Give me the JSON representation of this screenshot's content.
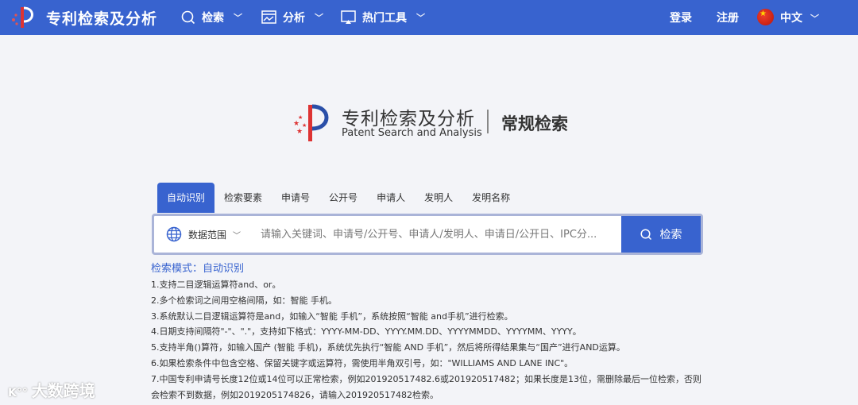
{
  "header": {
    "brand": "专利检索及分析",
    "nav": [
      {
        "label": "检索",
        "icon": "search-icon"
      },
      {
        "label": "分析",
        "icon": "chart-icon"
      },
      {
        "label": "热门工具",
        "icon": "monitor-icon"
      }
    ],
    "login": "登录",
    "register": "注册",
    "language": "中文"
  },
  "hero": {
    "title_cn": "专利检索及分析",
    "title_en": "Patent Search and Analysis",
    "subtitle": "常规检索"
  },
  "tabs": [
    "自动识别",
    "检索要素",
    "申请号",
    "公开号",
    "申请人",
    "发明人",
    "发明名称"
  ],
  "search": {
    "scope_label": "数据范围",
    "placeholder": "请输入关键词、申请号/公开号、申请人/发明人、申请日/公开日、IPC分...",
    "button": "检索"
  },
  "mode": "检索模式：自动识别",
  "tips": [
    "1.支持二目逻辑运算符and、or。",
    "2.多个检索词之间用空格间隔，如：智能 手机。",
    "3.系统默认二目逻辑运算符是and，如输入“智能 手机”，系统按照“智能 and手机”进行检索。",
    "4.日期支持间隔符\"-\"、\".\"，支持如下格式：YYYY-MM-DD、YYYY.MM.DD、YYYYMMDD、YYYYMM、YYYY。",
    "5.支持半角()算符，如输入国产 (智能 手机)，系统优先执行“智能 AND 手机”，然后将所得结果集与“国产”进行AND运算。",
    "6.如果检索条件中包含空格、保留关键字或运算符，需使用半角双引号，如：\"WILLIAMS AND LANE INC\"。",
    "7.中国专利申请号长度12位或14位可以正常检索，例如201920517482.6或201920517482；如果长度是13位，需删除最后一位检索，否则会检索不到数据，例如2019205174826，请输入201920517482检索。"
  ],
  "watermark": "大数跨境"
}
